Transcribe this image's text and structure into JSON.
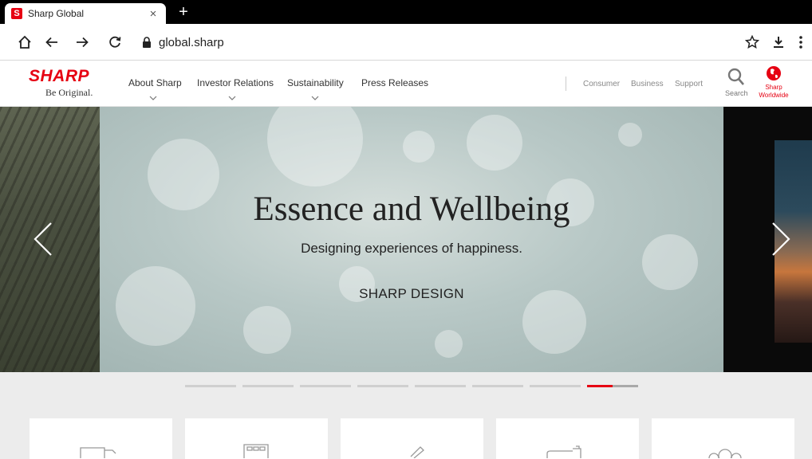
{
  "browser": {
    "tab_title": "Sharp Global",
    "tab_close": "×",
    "new_tab": "+",
    "url": "global.sharp"
  },
  "header": {
    "logo_word": "SHARP",
    "logo_tagline": "Be Original.",
    "nav": [
      {
        "label": "About Sharp",
        "has_dropdown": true
      },
      {
        "label": "Investor Relations",
        "has_dropdown": true
      },
      {
        "label": "Sustainability",
        "has_dropdown": true
      },
      {
        "label": "Press Releases",
        "has_dropdown": false
      }
    ],
    "utility_links": [
      "Consumer",
      "Business",
      "Support"
    ],
    "search_label": "Search",
    "worldwide_label_1": "Sharp",
    "worldwide_label_2": "Worldwide"
  },
  "hero": {
    "title": "Essence and Wellbeing",
    "subtitle": "Designing experiences of happiness.",
    "link_label": "SHARP DESIGN"
  },
  "pager": {
    "count": 8,
    "active_index": 7
  },
  "tiles_count": 5,
  "colors": {
    "brand_red": "#e60012",
    "hero_bg": "#b8c8c6"
  }
}
